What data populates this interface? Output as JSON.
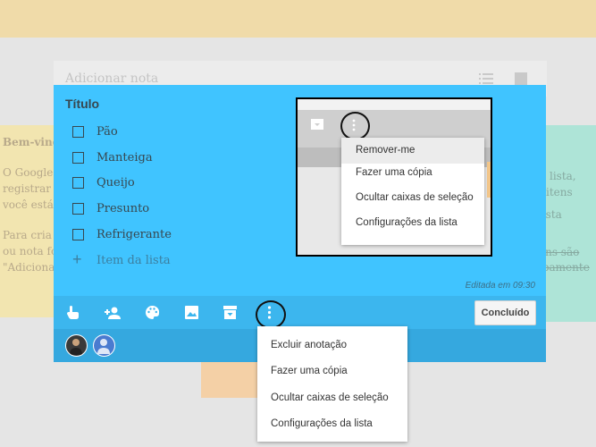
{
  "add_note": {
    "placeholder": "Adicionar nota"
  },
  "background_note_left": {
    "lines": [
      "Bem-vindo",
      "O Google",
      "registrar",
      "você está",
      "Para cria",
      "ou nota fo",
      "\"Adiciona"
    ]
  },
  "background_note_right": {
    "lines": [
      "lista,",
      "itens",
      "lista",
      "ens são",
      "ipamente"
    ]
  },
  "note": {
    "title": "Título",
    "items": [
      {
        "label": "Pão",
        "checked": false
      },
      {
        "label": "Manteiga",
        "checked": false
      },
      {
        "label": "Queijo",
        "checked": false
      },
      {
        "label": "Presunto",
        "checked": false
      },
      {
        "label": "Refrigerante",
        "checked": false
      }
    ],
    "add_item_label": "Item da lista",
    "edited": "Editada em 09:30",
    "toolbar": {
      "icons": [
        "reminder-hand-icon",
        "add-collaborator-icon",
        "palette-icon",
        "image-icon",
        "archive-icon",
        "more-vertical-icon"
      ],
      "done_label": "Concluído"
    },
    "collaborators": [
      "owner-avatar",
      "collaborator-avatar"
    ]
  },
  "menu": {
    "items": [
      "Excluir anotação",
      "Fazer uma cópia",
      "Ocultar caixas de seleção",
      "Configurações da lista"
    ]
  },
  "inset": {
    "menu_items": [
      "Remover-me",
      "Fazer uma cópia",
      "Ocultar caixas de seleção",
      "Configurações da lista"
    ],
    "highlighted_index": 0
  },
  "colors": {
    "note_bg": "#40c4ff",
    "toolbar_bg": "#3cb6ee",
    "collab_bg": "#35a8df",
    "page_bg": "#e5e5e5"
  }
}
